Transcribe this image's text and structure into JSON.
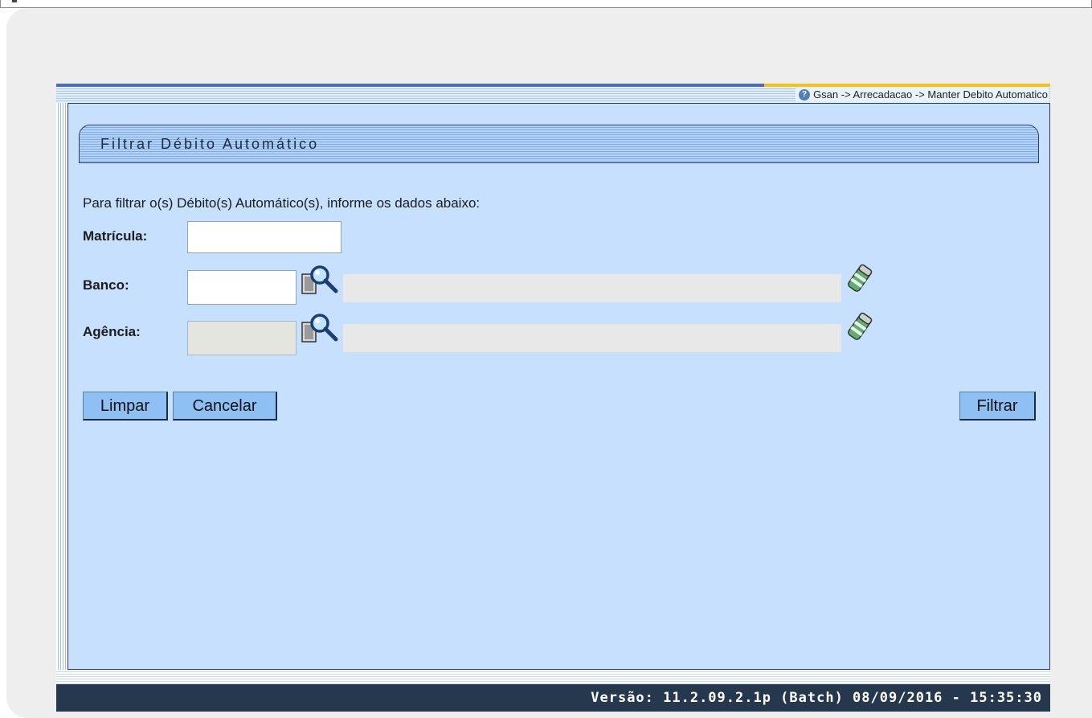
{
  "breadcrumb": "Gsan -> Arrecadacao -> Manter Debito Automatico",
  "form": {
    "title": "Filtrar Débito Automático",
    "instructions": "Para filtrar o(s) Débito(s) Automático(s), informe os dados abaixo:",
    "matricula": {
      "label": "Matrícula:",
      "value": ""
    },
    "banco": {
      "label": "Banco:",
      "value": "",
      "description": ""
    },
    "agencia": {
      "label": "Agência:",
      "value": "",
      "description": ""
    }
  },
  "buttons": {
    "limpar": "Limpar",
    "cancelar": "Cancelar",
    "filtrar": "Filtrar"
  },
  "footer": {
    "version": "Versão: 11.2.09.2.1p (Batch) 08/09/2016 - 15:35:30"
  },
  "icons": {
    "help": "help-icon",
    "search": "search-magnifier-icon",
    "clear": "eraser-icon"
  },
  "colors": {
    "panel": "#c6e0fd",
    "button": "#8ec0f4",
    "footer": "#25384d",
    "accent": "#f0c419"
  }
}
